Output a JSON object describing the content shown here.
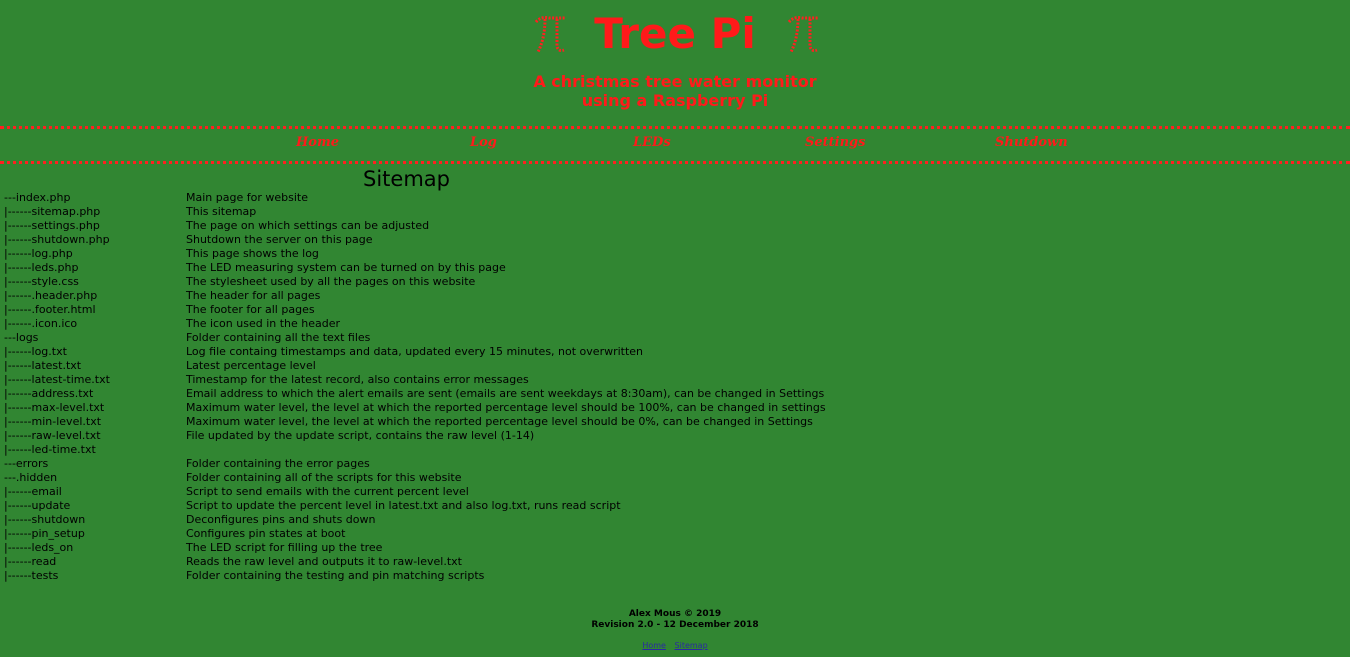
{
  "header": {
    "title": "Tree Pi",
    "tagline_line1": "A christmas tree water monitor",
    "tagline_line2": "using a Raspberry Pi",
    "icon": "pi-icon"
  },
  "nav": {
    "home": "Home",
    "log": "Log",
    "leds": "LEDs",
    "settings": "Settings",
    "shutdown": "Shutdown"
  },
  "page": {
    "heading": "Sitemap"
  },
  "sitemap": [
    {
      "path": "---index.php",
      "desc": "Main page for website"
    },
    {
      "path": "|------sitemap.php",
      "desc": "This sitemap"
    },
    {
      "path": "|------settings.php",
      "desc": "The page on which settings can be adjusted"
    },
    {
      "path": "|------shutdown.php",
      "desc": "Shutdown the server on this page"
    },
    {
      "path": "|------log.php",
      "desc": "This page shows the log"
    },
    {
      "path": "|------leds.php",
      "desc": "The LED measuring system can be turned on by this page"
    },
    {
      "path": "|------style.css",
      "desc": "The stylesheet used by all the pages on this website"
    },
    {
      "path": "|------.header.php",
      "desc": "The header for all pages"
    },
    {
      "path": "|------.footer.html",
      "desc": "The footer for all pages"
    },
    {
      "path": "|------.icon.ico",
      "desc": "The icon used in the header"
    },
    {
      "path": "---logs",
      "desc": "Folder containing all the text files"
    },
    {
      "path": "|------log.txt",
      "desc": "Log file containg timestamps and data, updated every 15 minutes, not overwritten"
    },
    {
      "path": "|------latest.txt",
      "desc": "Latest percentage level"
    },
    {
      "path": "|------latest-time.txt",
      "desc": "Timestamp for the latest record, also contains error messages"
    },
    {
      "path": "|------address.txt",
      "desc": "Email address to which the alert emails are sent (emails are sent weekdays at 8:30am), can be changed in Settings"
    },
    {
      "path": "|------max-level.txt",
      "desc": "Maximum water level, the level at which the reported percentage level should be 100%, can be changed in settings"
    },
    {
      "path": "|------min-level.txt",
      "desc": "Maximum water level, the level at which the reported percentage level should be 0%, can be changed in Settings"
    },
    {
      "path": "|------raw-level.txt",
      "desc": "File updated by the update script, contains the raw level (1-14)"
    },
    {
      "path": "|------led-time.txt",
      "desc": ""
    },
    {
      "path": "---errors",
      "desc": "Folder containing the error pages"
    },
    {
      "path": "---.hidden",
      "desc": "Folder containing all of the scripts for this website"
    },
    {
      "path": "|------email",
      "desc": "Script to send emails with the current percent level"
    },
    {
      "path": "|------update",
      "desc": "Script to update the percent level in latest.txt and also log.txt, runs read script"
    },
    {
      "path": "|------shutdown",
      "desc": "Deconfigures pins and shuts down"
    },
    {
      "path": "|------pin_setup",
      "desc": "Configures pin states at boot"
    },
    {
      "path": "|------leds_on",
      "desc": "The LED script for filling up the tree"
    },
    {
      "path": "|------read",
      "desc": "Reads the raw level and outputs it to raw-level.txt"
    },
    {
      "path": "|------tests",
      "desc": "Folder containing the testing and pin matching scripts"
    }
  ],
  "footer": {
    "copyright": "Alex Mous © 2019",
    "revision": "Revision 2.0 - 12 December 2018",
    "link_home": "Home",
    "link_sitemap": "Sitemap"
  },
  "colors": {
    "background": "#318632",
    "accent": "#ff1a1a"
  }
}
